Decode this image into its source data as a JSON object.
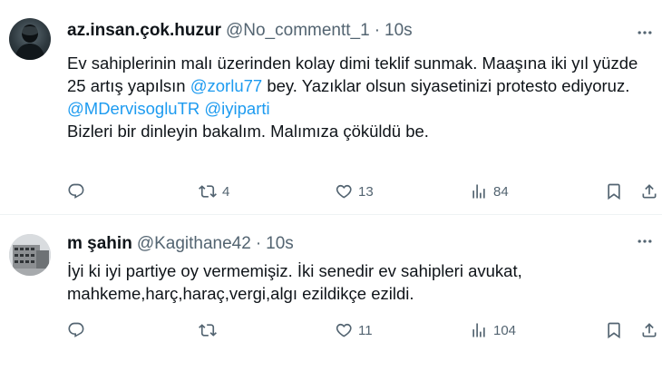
{
  "tweets": [
    {
      "display_name": "az.insan.çok.huzur",
      "handle": "@No_commentt_1",
      "separator": "·",
      "time": "10s",
      "text_segments": [
        [
          "Ev sahiplerinin malı üzerinden kolay dimi teklif sunmak. Maaşına iki yıl yüzde 25 artış yapılsın ",
          "@zorlu77",
          " bey. Yazıklar olsun siyasetinizi protesto ediyoruz."
        ],
        [
          "",
          "@MDervisogluTR",
          " ",
          "@iyiparti"
        ],
        [
          "Bizleri bir dinleyin bakalım. Malımıza çöküldü be."
        ]
      ],
      "line1": "Ev sahiplerinin malı üzerinden kolay dimi teklif sunmak. Maaşına iki yıl yüzde 25 artış yapılsın ",
      "mention1": "@zorlu77",
      "line1b": " bey. Yazıklar olsun siyasetinizi protesto ediyoruz.",
      "mention2": "@MDervisogluTR",
      "mention3": "@iyiparti",
      "line3": "Bizleri bir dinleyin bakalım. Malımıza çöküldü be.",
      "retweets": "4",
      "likes": "13",
      "views": "84"
    },
    {
      "display_name": "m şahin",
      "handle": "@Kagithane42",
      "separator": "·",
      "time": "10s",
      "text": "İyi ki iyi partiye oy vermemişiz. İki senedir ev sahipleri avukat, mahkeme,harç,haraç,vergi,algı ezildikçe ezildi.",
      "replies": "",
      "retweets": "",
      "likes": "11",
      "views": "104"
    }
  ],
  "colors": {
    "text": "#0f1419",
    "secondary": "#536471",
    "link": "#1d9bf0",
    "divider": "#eff3f4"
  },
  "icons": [
    "reply-icon",
    "retweet-icon",
    "like-icon",
    "views-icon",
    "bookmark-icon",
    "share-icon",
    "more-icon"
  ]
}
